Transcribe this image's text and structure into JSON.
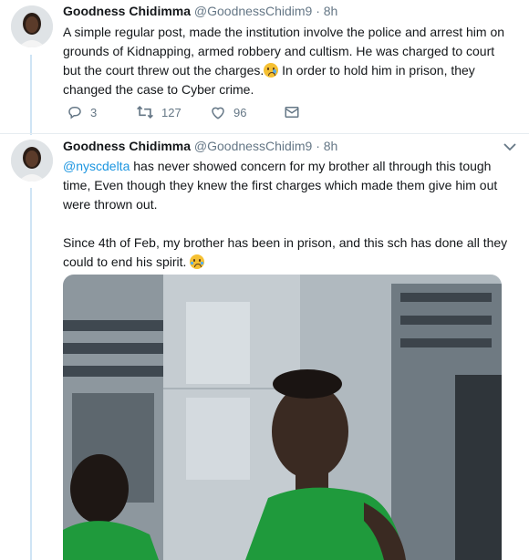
{
  "tweets": [
    {
      "name": "Goodness Chidimma",
      "handle": "@GoodnessChidim9",
      "dot": "·",
      "time": "8h",
      "text_1": "A simple regular post, made the institution involve the police and arrest him on grounds of Kidnapping, armed robbery and cultism. He was charged to court but the court threw out the charges.",
      "emoji_1": "crying-face",
      "text_2": " In order to hold him in prison, they changed the case to Cyber crime.",
      "actions": {
        "reply_count": "3",
        "retweet_count": "127",
        "like_count": "96"
      }
    },
    {
      "name": "Goodness Chidimma",
      "handle": "@GoodnessChidim9",
      "dot": "·",
      "time": "8h",
      "mention": "@nyscdelta",
      "text_1": " has never showed concern for my brother all through this tough time, Even though they knew the first charges which made them give him out were thrown out.",
      "text_2": "Since 4th of Feb, my brother has been in prison, and this sch has done all they could to end his spirit. ",
      "emoji_2": "loudly-crying-face"
    }
  ],
  "icons": {
    "reply": "reply-icon",
    "retweet": "retweet-icon",
    "like": "heart-icon",
    "message": "envelope-icon",
    "more": "chevron-down-icon"
  },
  "colors": {
    "accent": "#1b95e0",
    "muted": "#657786",
    "thread_line": "#cfe4f5",
    "shirt": "#1f9a3c"
  }
}
